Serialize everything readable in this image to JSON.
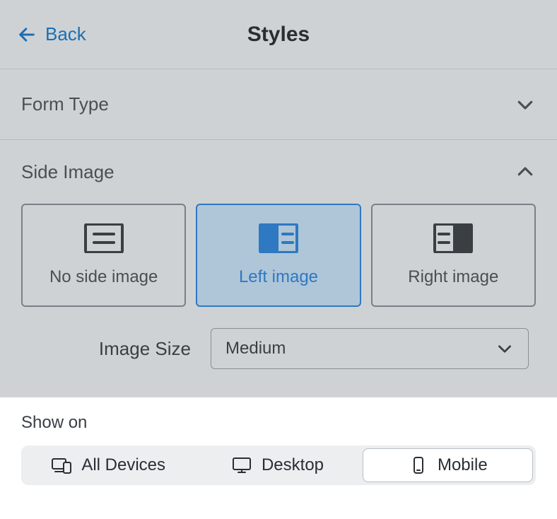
{
  "header": {
    "back_label": "Back",
    "title": "Styles"
  },
  "sections": {
    "form_type": {
      "label": "Form Type",
      "expanded": false
    },
    "side_image": {
      "label": "Side Image",
      "expanded": true
    }
  },
  "side_image_options": [
    {
      "label": "No side image",
      "selected": false
    },
    {
      "label": "Left image",
      "selected": true
    },
    {
      "label": "Right image",
      "selected": false
    }
  ],
  "image_size": {
    "label": "Image Size",
    "value": "Medium"
  },
  "show_on": {
    "label": "Show on",
    "options": [
      {
        "label": "All Devices",
        "selected": false
      },
      {
        "label": "Desktop",
        "selected": false
      },
      {
        "label": "Mobile",
        "selected": true
      }
    ]
  }
}
